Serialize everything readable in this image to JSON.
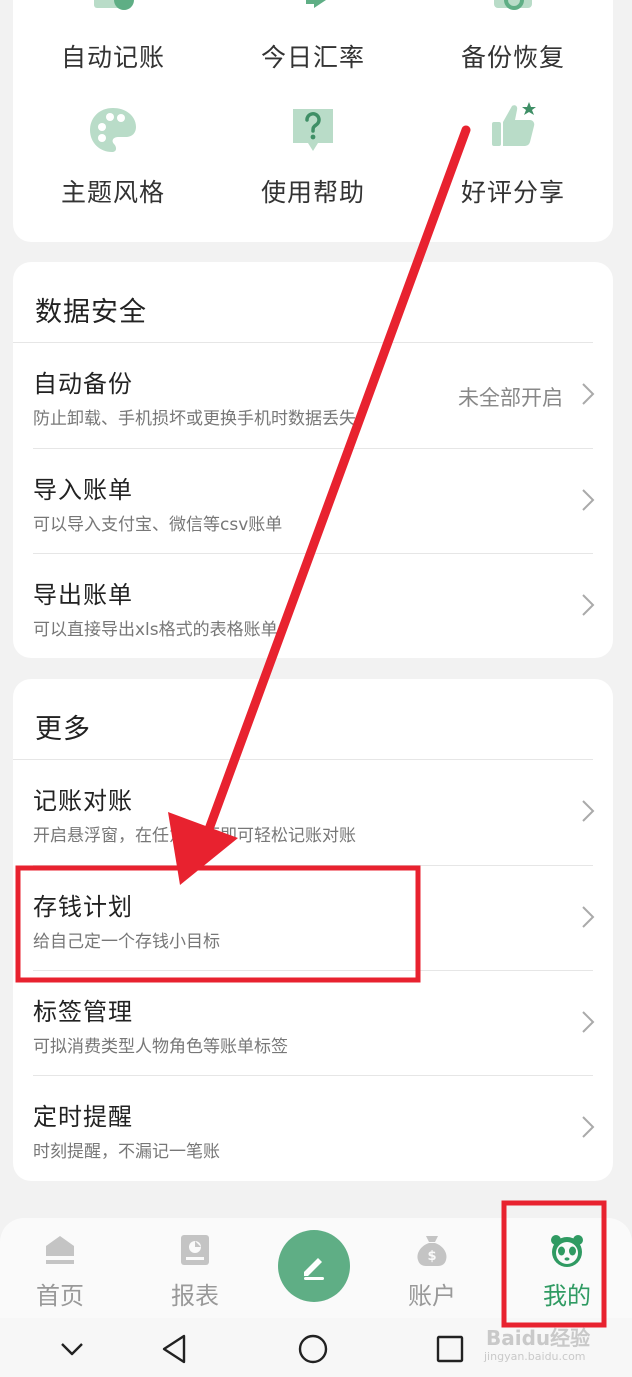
{
  "tools": {
    "row1": [
      {
        "label": "自动记账",
        "icon": "auto-bookkeeping-icon"
      },
      {
        "label": "今日汇率",
        "icon": "exchange-rate-icon"
      },
      {
        "label": "备份恢复",
        "icon": "backup-restore-icon"
      }
    ],
    "row2": [
      {
        "label": "主题风格",
        "icon": "palette-icon"
      },
      {
        "label": "使用帮助",
        "icon": "help-icon"
      },
      {
        "label": "好评分享",
        "icon": "thumbs-up-icon"
      }
    ]
  },
  "data_security": {
    "title": "数据安全",
    "items": [
      {
        "title": "自动备份",
        "subtitle": "防止卸载、手机损坏或更换手机时数据丢失",
        "value": "未全部开启"
      },
      {
        "title": "导入账单",
        "subtitle": "可以导入支付宝、微信等csv账单"
      },
      {
        "title": "导出账单",
        "subtitle": "可以直接导出xls格式的表格账单"
      }
    ]
  },
  "more": {
    "title": "更多",
    "items": [
      {
        "title": "记账对账",
        "subtitle": "开启悬浮窗，在任意页面即可轻松记账对账"
      },
      {
        "title": "存钱计划",
        "subtitle": "给自己定一个存钱小目标"
      },
      {
        "title": "标签管理",
        "subtitle": "可拟消费类型人物角色等账单标签"
      },
      {
        "title": "定时提醒",
        "subtitle": "时刻提醒，不漏记一笔账"
      }
    ]
  },
  "tabbar": {
    "home": "首页",
    "reports": "报表",
    "accounts": "账户",
    "mine": "我的"
  },
  "watermark": {
    "line1": "Baidu经验",
    "line2": "jingyan.baidu.com"
  },
  "colors": {
    "accent": "#5fae85",
    "active_tab": "#2f9a62",
    "annotation": "#e8222f"
  }
}
